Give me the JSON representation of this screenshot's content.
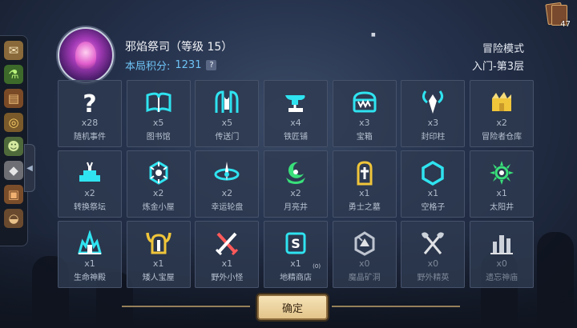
{
  "header": {
    "boss_name": "邪焰祭司（等级 15）",
    "score_label": "本局积分:",
    "score_value": "1231",
    "help": "?",
    "mode": "冒险模式",
    "floor": "入门-第3层"
  },
  "deck": {
    "count": "47"
  },
  "tiles": [
    {
      "count": "x28",
      "name": "随机事件",
      "icon": "question-icon"
    },
    {
      "count": "x5",
      "name": "图书馆",
      "icon": "book-icon"
    },
    {
      "count": "x5",
      "name": "传送门",
      "icon": "portal-icon"
    },
    {
      "count": "x4",
      "name": "铁匠铺",
      "icon": "anvil-icon"
    },
    {
      "count": "x3",
      "name": "宝箱",
      "icon": "chest-icon"
    },
    {
      "count": "x3",
      "name": "封印柱",
      "icon": "seal-pillar-icon"
    },
    {
      "count": "x2",
      "name": "冒险者仓库",
      "icon": "warehouse-icon"
    },
    {
      "count": "x2",
      "name": "转换祭坛",
      "icon": "altar-icon"
    },
    {
      "count": "x2",
      "name": "炼金小屋",
      "icon": "alchemy-icon"
    },
    {
      "count": "x2",
      "name": "幸运轮盘",
      "icon": "wheel-icon"
    },
    {
      "count": "x2",
      "name": "月亮井",
      "icon": "moon-well-icon"
    },
    {
      "count": "x1",
      "name": "勇士之墓",
      "icon": "tomb-icon"
    },
    {
      "count": "x1",
      "name": "空格子",
      "icon": "hexagon-icon"
    },
    {
      "count": "x1",
      "name": "太阳井",
      "icon": "sun-well-icon"
    },
    {
      "count": "x1",
      "name": "生命神殿",
      "icon": "temple-icon"
    },
    {
      "count": "x1",
      "name": "矮人宝屋",
      "icon": "dwarf-helmet-icon"
    },
    {
      "count": "x1",
      "name": "野外小怪",
      "icon": "crossed-swords-icon"
    },
    {
      "count": "x1",
      "name": "地精商店",
      "icon": "shop-icon",
      "tag": "(0)"
    },
    {
      "count": "x0",
      "name": "魔晶矿洞",
      "icon": "mine-icon"
    },
    {
      "count": "x0",
      "name": "野外精英",
      "icon": "crossed-axes-icon"
    },
    {
      "count": "x0",
      "name": "遗忘神庙",
      "icon": "forgotten-temple-icon"
    }
  ],
  "confirm_label": "确定",
  "colors": {
    "accent": "#2fe3f0",
    "gold": "#f0c53a",
    "green": "#39e07a"
  }
}
